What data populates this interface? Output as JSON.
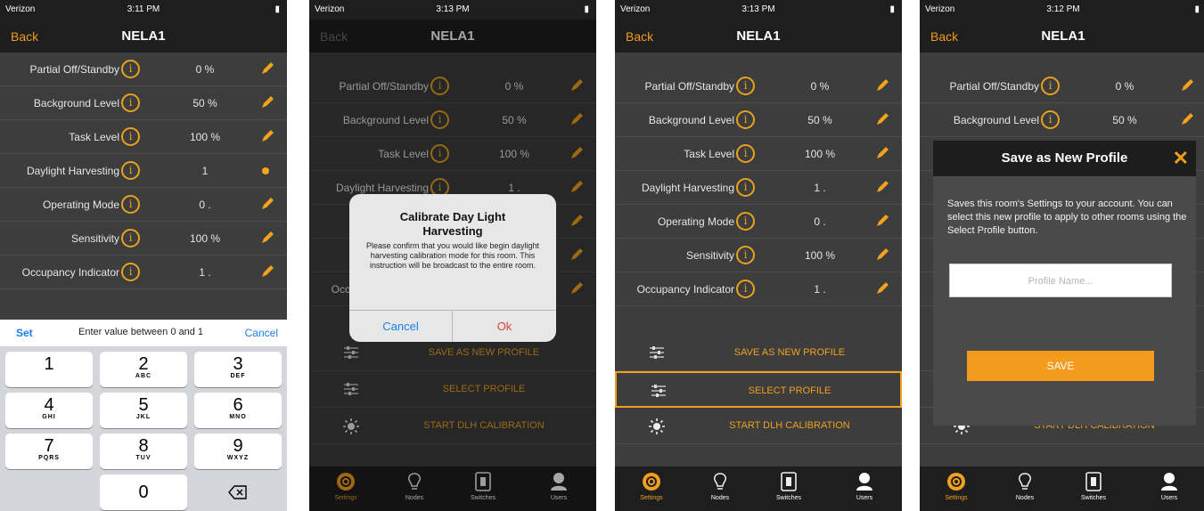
{
  "status": {
    "carrier": "Verizon",
    "times": [
      "3:11 PM",
      "3:13 PM",
      "3:13 PM",
      "3:12 PM"
    ]
  },
  "nav": {
    "back": "Back",
    "title": "NELA1"
  },
  "settings": [
    {
      "label": "Partial Off/Standby",
      "value": "0 %"
    },
    {
      "label": "Background Level",
      "value": "50 %"
    },
    {
      "label": "Task Level",
      "value": "100 %"
    },
    {
      "label": "Daylight Harvesting",
      "value": "1"
    },
    {
      "label": "Operating Mode",
      "value": "0 ."
    },
    {
      "label": "Sensitivity",
      "value": "100 %"
    },
    {
      "label": "Occupancy Indicator",
      "value": "1 ."
    }
  ],
  "settings_p3": [
    {
      "label": "Partial Off/Standby",
      "value": "0 %"
    },
    {
      "label": "Background Level",
      "value": "50 %"
    },
    {
      "label": "Task Level",
      "value": "100 %"
    },
    {
      "label": "Daylight Harvesting",
      "value": "1 ."
    },
    {
      "label": "Operating Mode",
      "value": "0 ."
    },
    {
      "label": "Sensitivity",
      "value": "100 %"
    },
    {
      "label": "Occupancy Indicator",
      "value": "1 ."
    }
  ],
  "actions": [
    "SAVE AS NEW PROFILE",
    "SELECT PROFILE",
    "START DLH CALIBRATION"
  ],
  "tabs": [
    "Settings",
    "Nodes",
    "Switches",
    "Users"
  ],
  "input_bar": {
    "set": "Set",
    "hint": "Enter value between 0 and 1",
    "cancel": "Cancel"
  },
  "keypad": [
    {
      "num": "1",
      "sub": ""
    },
    {
      "num": "2",
      "sub": "ABC"
    },
    {
      "num": "3",
      "sub": "DEF"
    },
    {
      "num": "4",
      "sub": "GHI"
    },
    {
      "num": "5",
      "sub": "JKL"
    },
    {
      "num": "6",
      "sub": "MNO"
    },
    {
      "num": "7",
      "sub": "PQRS"
    },
    {
      "num": "8",
      "sub": "TUV"
    },
    {
      "num": "9",
      "sub": "WXYZ"
    },
    {
      "num": "0",
      "sub": ""
    }
  ],
  "alert": {
    "title": "Calibrate Day Light Harvesting",
    "message": "Please confirm that you would like begin daylight harvesting calibration mode for this room. This instruction will be broadcast to the entire room.",
    "cancel": "Cancel",
    "ok": "Ok"
  },
  "modal": {
    "title": "Save as New Profile",
    "close": "✕",
    "description": "Saves this room's Settings to your account. You can select this new profile to apply to other rooms using the Select Profile button.",
    "placeholder": "Profile Name...",
    "save": "SAVE"
  },
  "colors": {
    "accent": "#f29b1c",
    "ios_blue": "#1a7ef0",
    "bg": "#3d3d3d",
    "bar": "#1e1e1e"
  }
}
